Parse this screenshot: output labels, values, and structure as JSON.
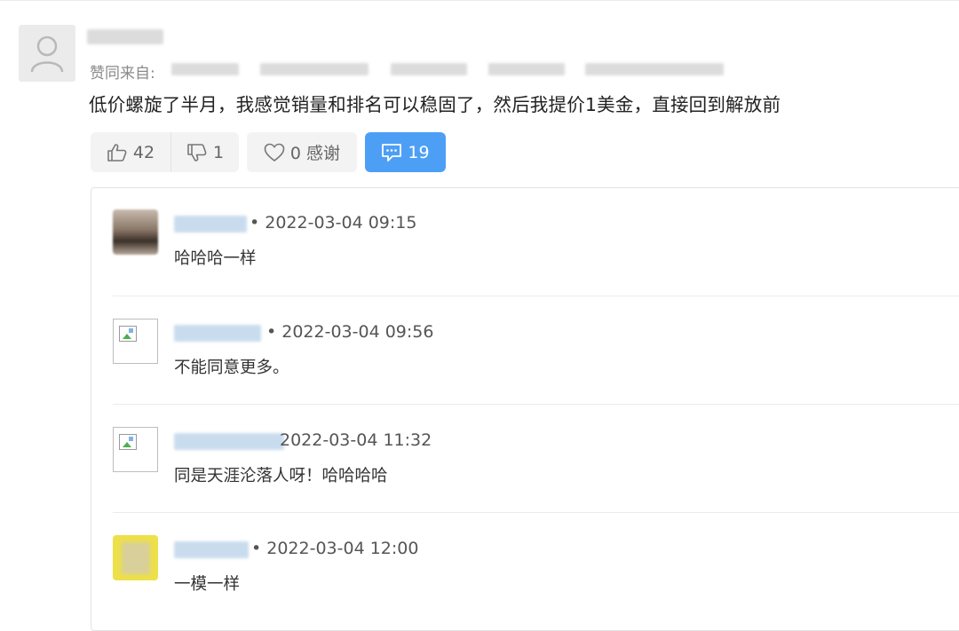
{
  "answer": {
    "author_name": "",
    "zan_from_label": "赞同来自:",
    "content": "低价螺旋了半月，我感觉销量和排名可以稳固了，然后我提价1美金，直接回到解放前",
    "actions": {
      "upvote_count": "42",
      "downvote_count": "1",
      "thanks_label": "0 感谢",
      "comments_count": "19"
    }
  },
  "replies": [
    {
      "avatar": "photo-avatar",
      "meta": "• 2022-03-04 09:15",
      "text": "哈哈哈一样"
    },
    {
      "avatar": "broken-image-icon",
      "meta": "• 2022-03-04 09:56",
      "text": "不能同意更多。"
    },
    {
      "avatar": "broken-image-icon",
      "meta": "2022-03-04 11:32",
      "text": "同是天涯沦落人呀！哈哈哈哈"
    },
    {
      "avatar": "yellow-avatar",
      "meta": "• 2022-03-04 12:00",
      "text": "一模一样"
    }
  ],
  "colors": {
    "accent": "#4d9ff5",
    "muted_text": "#8a8a8a",
    "button_bg": "#f3f3f3",
    "border": "#e3e3e3"
  }
}
